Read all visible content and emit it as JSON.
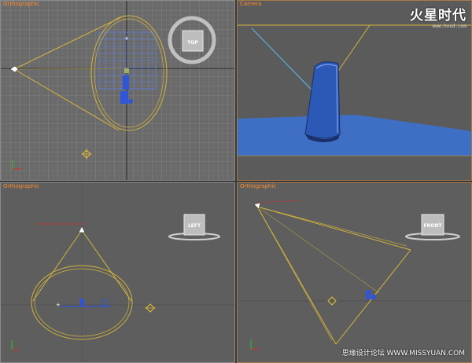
{
  "viewports": {
    "top_left": {
      "label": "Orthographic"
    },
    "top_right": {
      "label": "Camera"
    },
    "bottom_left": {
      "label": "Orthographic"
    },
    "bottom_right": {
      "label": "Orthographic"
    }
  },
  "viewcube": {
    "top_label": "TOP",
    "left_label": "LEFT",
    "front_label": "FRONT"
  },
  "watermarks": {
    "logo_text": "火星时代",
    "logo_url": "www.hxsd.com",
    "bottom_text": "思缘设计论坛 WWW.MISSYUAN.COM"
  },
  "colors": {
    "light_cone": "#d4b53a",
    "selection_blue": "#2f55d8",
    "viewport_label": "#ff8c2a",
    "grid_highlight": "#5c7fe8"
  }
}
